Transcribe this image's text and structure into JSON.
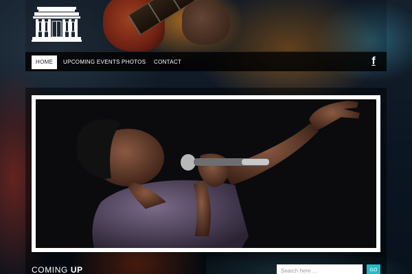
{
  "nav": {
    "items": [
      {
        "label": "HOME",
        "active": true
      },
      {
        "label": "UPCOMING EVENTS",
        "active": false
      },
      {
        "label": "PHOTOS",
        "active": false
      },
      {
        "label": "CONTACT",
        "active": false
      }
    ],
    "social_icon": "facebook-icon",
    "social_glyph": "f"
  },
  "logo": {
    "icon": "building-icon"
  },
  "hero": {
    "image": "singer-on-stage-photo"
  },
  "sections": {
    "coming_up_prefix": "COMING ",
    "coming_up_strong": "UP"
  },
  "search": {
    "placeholder": "Search here ...",
    "button_label": "GO"
  },
  "colors": {
    "accent": "#2bb8c4",
    "nav_bg": "#000000",
    "active_tab_bg": "#ffffff"
  }
}
